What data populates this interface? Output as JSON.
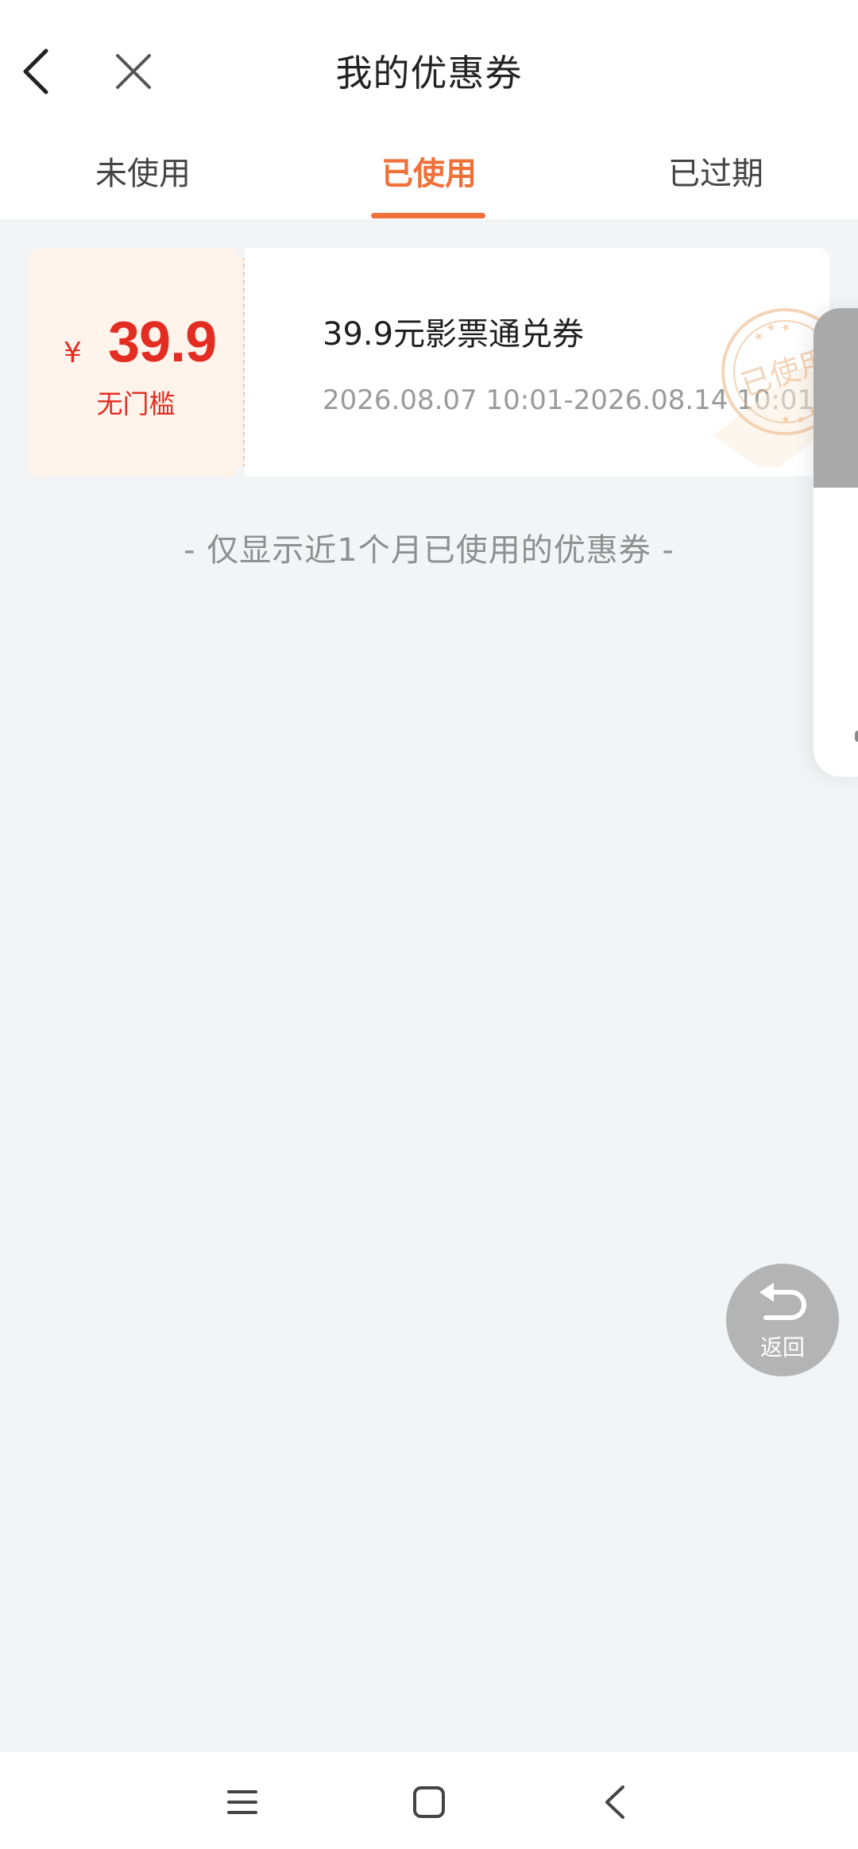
{
  "header": {
    "title": "我的优惠券",
    "icons": {
      "back": "back-chevron-icon",
      "close": "close-icon"
    }
  },
  "tabs": [
    {
      "label": "未使用",
      "active": false
    },
    {
      "label": "已使用",
      "active": true
    },
    {
      "label": "已过期",
      "active": false
    }
  ],
  "colors": {
    "accent": "#f07039",
    "price": "#e32d22",
    "background": "#f3f4f6"
  },
  "coupons": [
    {
      "currency": "¥",
      "amount": "39.9",
      "condition": "无门槛",
      "name": "39.9元影票通兑券",
      "validity": "2026.08.07 10:01-2026.08.14 10:01",
      "stamp": "已使用"
    }
  ],
  "note": "- 仅显示近1个月已使用的优惠券 -",
  "floating": {
    "return_label": "返回",
    "icon": "undo-arrow-icon"
  },
  "navbar": {
    "icons": [
      "menu-icon",
      "home-square-icon",
      "back-chevron-icon"
    ]
  }
}
